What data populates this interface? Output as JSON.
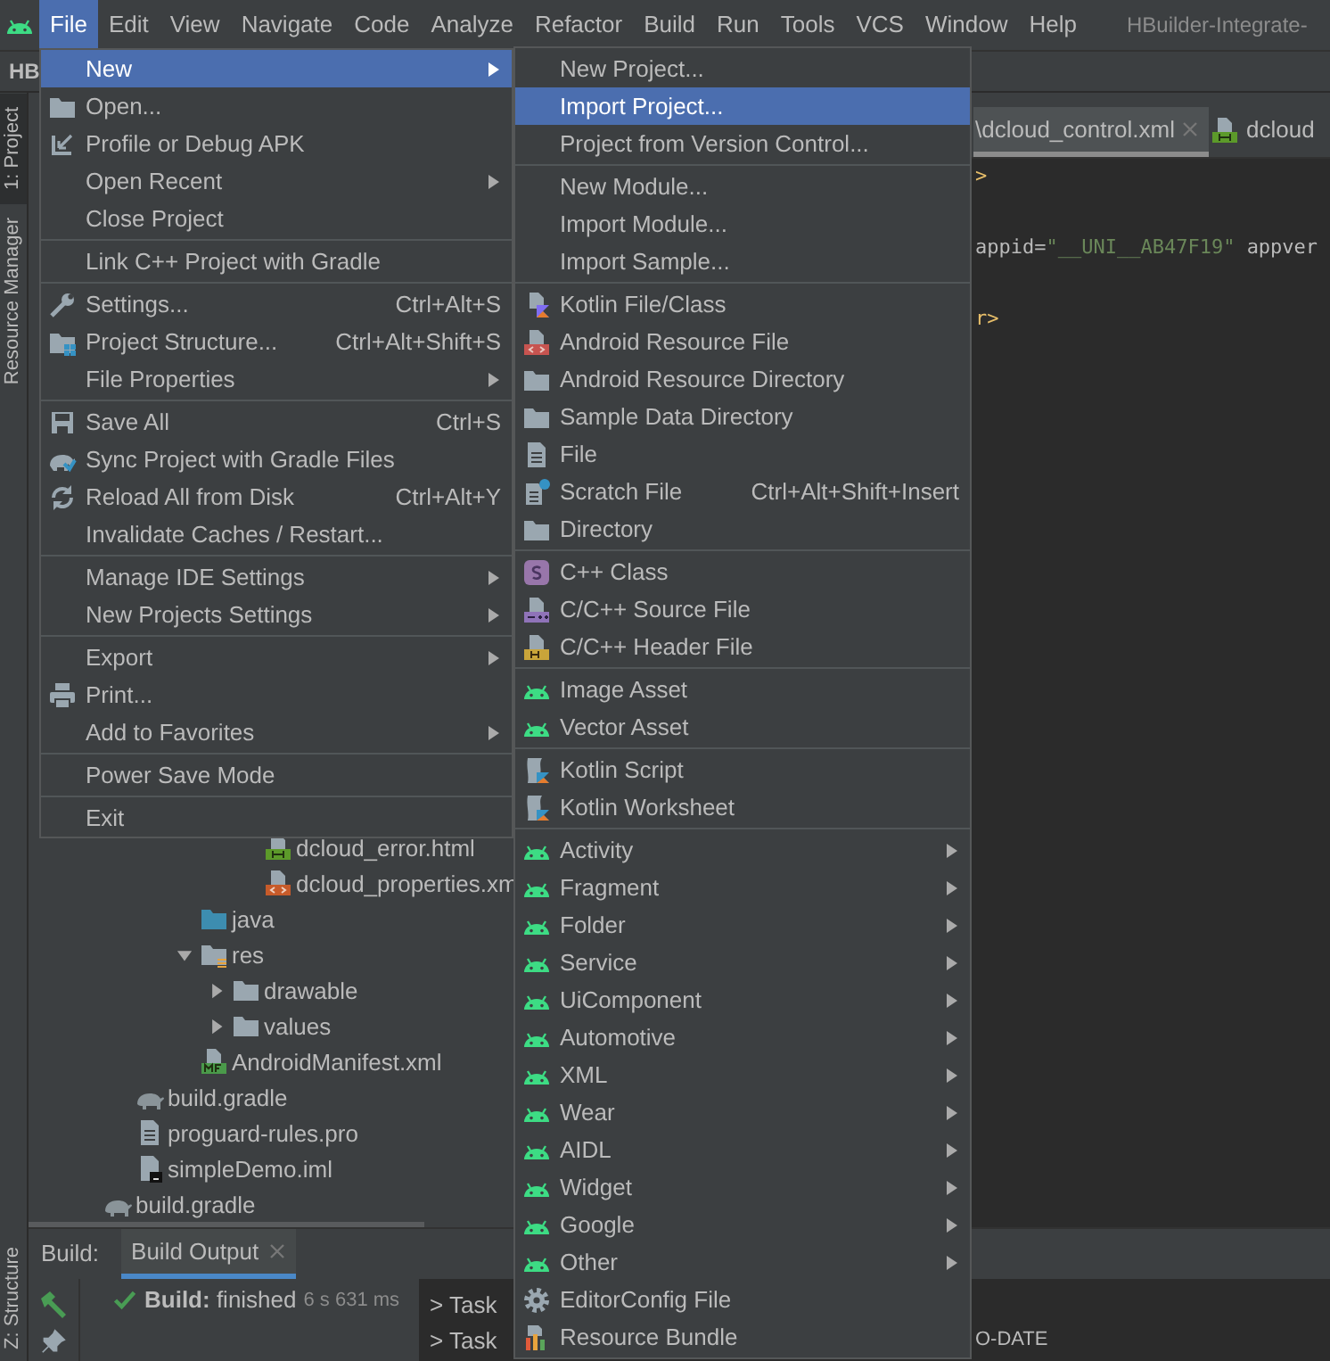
{
  "menu_bar": {
    "items": [
      {
        "label": "File",
        "selected": true
      },
      {
        "label": "Edit",
        "selected": false
      },
      {
        "label": "View",
        "selected": false
      },
      {
        "label": "Navigate",
        "selected": false
      },
      {
        "label": "Code",
        "selected": false
      },
      {
        "label": "Analyze",
        "selected": false
      },
      {
        "label": "Refactor",
        "selected": false
      },
      {
        "label": "Build",
        "selected": false
      },
      {
        "label": "Run",
        "selected": false
      },
      {
        "label": "Tools",
        "selected": false
      },
      {
        "label": "VCS",
        "selected": false
      },
      {
        "label": "Window",
        "selected": false
      },
      {
        "label": "Help",
        "selected": false
      }
    ],
    "title": "HBuilder-Integrate-"
  },
  "toolbar": {
    "project_label": "HB"
  },
  "side_strip": [
    {
      "label": "1: Project",
      "selected": true
    },
    {
      "label": "Resource Manager",
      "selected": false
    }
  ],
  "side_strip_bottom": [
    {
      "label": "Z: Structure",
      "selected": false
    }
  ],
  "project_tree": [
    {
      "children": [
        {
          "children": [
            {
              "children": [
                {
                  "children": [
                    {
                      "children": [
                        {
                          "label": "dcloud_error.html",
                          "kind": "html"
                        },
                        {
                          "label": "dcloud_properties.xm",
                          "kind": "xml"
                        }
                      ]
                    }
                  ]
                },
                {
                  "label": "java",
                  "kind": "source_folder"
                },
                {
                  "label": "res",
                  "kind": "resource_folder",
                  "expanded": true,
                  "children": [
                    {
                      "label": "drawable",
                      "kind": "folder",
                      "expanded": false
                    },
                    {
                      "label": "values",
                      "kind": "folder",
                      "expanded": false
                    }
                  ]
                },
                {
                  "label": "AndroidManifest.xml",
                  "kind": "manifest"
                }
              ]
            }
          ]
        },
        {
          "label": "build.gradle",
          "kind": "gradle"
        },
        {
          "label": "proguard-rules.pro",
          "kind": "text"
        },
        {
          "label": "simpleDemo.iml",
          "kind": "module_file"
        }
      ]
    },
    {
      "label": "build.gradle",
      "kind": "gradle"
    }
  ],
  "editor": {
    "tabs": [
      {
        "label": "\\dcloud_control.xml",
        "kind": "none",
        "selected": true,
        "closable": true
      },
      {
        "label": "dcloud",
        "kind": "html",
        "selected": false,
        "closable": false
      }
    ],
    "lines": [
      [
        {
          "kind": "tag",
          "text": ">"
        }
      ],
      [
        {
          "kind": "attr",
          "text": "appid="
        },
        {
          "kind": "value",
          "text": "\"__UNI__AB47F19\""
        },
        {
          "kind": "attr",
          "text": "appver"
        }
      ],
      [
        {
          "kind": "tag",
          "text": "r>"
        }
      ]
    ]
  },
  "build_panel": {
    "label": "Build:",
    "tabs": [
      {
        "label": "Build Output",
        "selected": true
      }
    ],
    "status": "**Build:** finished",
    "duration": "6 s 631 ms",
    "console_lines": [
      {
        "text": "> Task"
      },
      {
        "text": "> Task",
        "tail": "O-DATE"
      }
    ]
  },
  "file_menu": [
    {
      "label": "New",
      "kind": "plain",
      "submenu": true,
      "selected": true
    },
    {
      "label": "Open...",
      "kind": "folder",
      "submenu": false,
      "selected": false
    },
    {
      "label": "Profile or Debug APK",
      "kind": "apk",
      "submenu": false,
      "selected": false
    },
    {
      "label": "Open Recent",
      "kind": "plain",
      "submenu": true,
      "selected": false
    },
    {
      "label": "Close Project",
      "kind": "plain",
      "submenu": false,
      "selected": false
    },
    {
      "kind": "separator"
    },
    {
      "label": "Link C++ Project with Gradle",
      "kind": "plain",
      "submenu": false,
      "selected": false
    },
    {
      "kind": "separator"
    },
    {
      "label": "Settings...",
      "kind": "wrench",
      "shortcut": "Ctrl+Alt+S",
      "submenu": false,
      "selected": false
    },
    {
      "label": "Project Structure...",
      "kind": "structure",
      "shortcut": "Ctrl+Alt+Shift+S",
      "submenu": false,
      "selected": false
    },
    {
      "label": "File Properties",
      "kind": "plain",
      "submenu": true,
      "selected": false
    },
    {
      "kind": "separator"
    },
    {
      "label": "Save All",
      "kind": "save",
      "shortcut": "Ctrl+S",
      "submenu": false,
      "selected": false
    },
    {
      "label": "Sync Project with Gradle Files",
      "kind": "sync",
      "submenu": false,
      "selected": false
    },
    {
      "label": "Reload All from Disk",
      "kind": "reload",
      "shortcut": "Ctrl+Alt+Y",
      "submenu": false,
      "selected": false
    },
    {
      "label": "Invalidate Caches / Restart...",
      "kind": "plain",
      "submenu": false,
      "selected": false
    },
    {
      "kind": "separator"
    },
    {
      "label": "Manage IDE Settings",
      "kind": "plain",
      "submenu": true,
      "selected": false
    },
    {
      "label": "New Projects Settings",
      "kind": "plain",
      "submenu": true,
      "selected": false
    },
    {
      "kind": "separator"
    },
    {
      "label": "Export",
      "kind": "plain",
      "submenu": true,
      "selected": false
    },
    {
      "label": "Print...",
      "kind": "printer",
      "submenu": false,
      "selected": false
    },
    {
      "label": "Add to Favorites",
      "kind": "plain",
      "submenu": true,
      "selected": false
    },
    {
      "kind": "separator"
    },
    {
      "label": "Power Save Mode",
      "kind": "plain",
      "submenu": false,
      "selected": false
    },
    {
      "kind": "separator"
    },
    {
      "label": "Exit",
      "kind": "plain",
      "submenu": false,
      "selected": false
    }
  ],
  "new_submenu": [
    {
      "label": "New Project...",
      "kind": "plain",
      "submenu": false,
      "selected": false
    },
    {
      "label": "Import Project...",
      "kind": "plain",
      "submenu": false,
      "selected": true
    },
    {
      "label": "Project from Version Control...",
      "kind": "plain",
      "submenu": false,
      "selected": false
    },
    {
      "kind": "separator"
    },
    {
      "label": "New Module...",
      "kind": "plain",
      "submenu": false,
      "selected": false
    },
    {
      "label": "Import Module...",
      "kind": "plain",
      "submenu": false,
      "selected": false
    },
    {
      "label": "Import Sample...",
      "kind": "plain",
      "submenu": false,
      "selected": false
    },
    {
      "kind": "separator"
    },
    {
      "label": "Kotlin File/Class",
      "kind": "kotlin",
      "submenu": false,
      "selected": false
    },
    {
      "label": "Android Resource File",
      "kind": "resource_file",
      "submenu": false,
      "selected": false
    },
    {
      "label": "Android Resource Directory",
      "kind": "folder",
      "submenu": false,
      "selected": false
    },
    {
      "label": "Sample Data Directory",
      "kind": "folder",
      "submenu": false,
      "selected": false
    },
    {
      "label": "File",
      "kind": "file",
      "submenu": false,
      "selected": false
    },
    {
      "label": "Scratch File",
      "kind": "scratch",
      "shortcut": "Ctrl+Alt+Shift+Insert",
      "submenu": false,
      "selected": false
    },
    {
      "label": "Directory",
      "kind": "folder",
      "submenu": false,
      "selected": false
    },
    {
      "kind": "separator"
    },
    {
      "label": "C++ Class",
      "kind": "cpp_class",
      "submenu": false,
      "selected": false
    },
    {
      "label": "C/C++ Source File",
      "kind": "cpp_source",
      "submenu": false,
      "selected": false
    },
    {
      "label": "C/C++ Header File",
      "kind": "cpp_header",
      "submenu": false,
      "selected": false
    },
    {
      "kind": "separator"
    },
    {
      "label": "Image Asset",
      "kind": "android",
      "submenu": false,
      "selected": false
    },
    {
      "label": "Vector Asset",
      "kind": "android",
      "submenu": false,
      "selected": false
    },
    {
      "kind": "separator"
    },
    {
      "label": "Kotlin Script",
      "kind": "kotlin_script",
      "submenu": false,
      "selected": false
    },
    {
      "label": "Kotlin Worksheet",
      "kind": "kotlin_script",
      "submenu": false,
      "selected": false
    },
    {
      "kind": "separator"
    },
    {
      "label": "Activity",
      "kind": "android",
      "submenu": true,
      "selected": false
    },
    {
      "label": "Fragment",
      "kind": "android",
      "submenu": true,
      "selected": false
    },
    {
      "label": "Folder",
      "kind": "android",
      "submenu": true,
      "selected": false
    },
    {
      "label": "Service",
      "kind": "android",
      "submenu": true,
      "selected": false
    },
    {
      "label": "UiComponent",
      "kind": "android",
      "submenu": true,
      "selected": false
    },
    {
      "label": "Automotive",
      "kind": "android",
      "submenu": true,
      "selected": false
    },
    {
      "label": "XML",
      "kind": "android",
      "submenu": true,
      "selected": false
    },
    {
      "label": "Wear",
      "kind": "android",
      "submenu": true,
      "selected": false
    },
    {
      "label": "AIDL",
      "kind": "android",
      "submenu": true,
      "selected": false
    },
    {
      "label": "Widget",
      "kind": "android",
      "submenu": true,
      "selected": false
    },
    {
      "label": "Google",
      "kind": "android",
      "submenu": true,
      "selected": false
    },
    {
      "label": "Other",
      "kind": "android",
      "submenu": true,
      "selected": false
    },
    {
      "label": "EditorConfig File",
      "kind": "gear",
      "submenu": false,
      "selected": false
    },
    {
      "label": "Resource Bundle",
      "kind": "bundle",
      "submenu": false,
      "selected": false
    }
  ]
}
